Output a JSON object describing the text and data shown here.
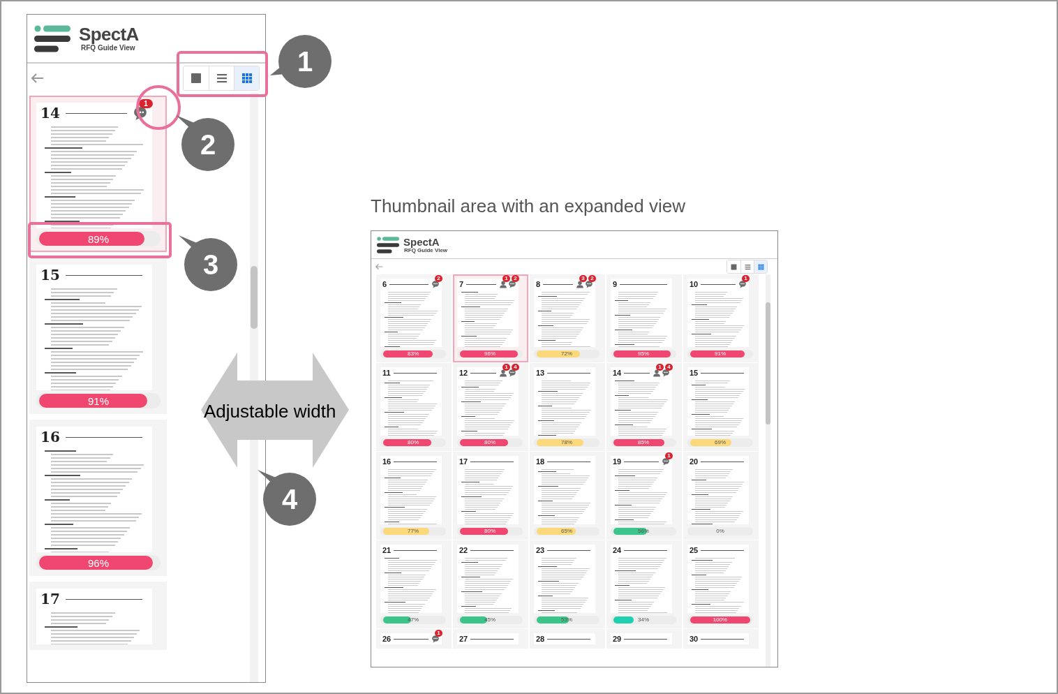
{
  "sidebar": {
    "logo": {
      "name": "SpectA",
      "subtitle": "RFQ Guide View"
    },
    "view_modes": [
      {
        "kind": "single",
        "selected": false
      },
      {
        "kind": "list",
        "selected": false
      },
      {
        "kind": "grid",
        "selected": true
      }
    ],
    "pages": [
      {
        "number": "14",
        "percent": "89%",
        "level": 0.89,
        "color": "#ef476f",
        "selected": true,
        "comments": [
          {
            "kind": "chat",
            "count": "1"
          }
        ]
      },
      {
        "number": "15",
        "percent": "91%",
        "level": 0.91,
        "color": "#ef476f",
        "selected": false
      },
      {
        "number": "16",
        "percent": "96%",
        "level": 0.96,
        "color": "#ef476f",
        "selected": false
      },
      {
        "number": "17",
        "selected": false
      }
    ]
  },
  "callouts": [
    {
      "label": "1"
    },
    {
      "label": "2"
    },
    {
      "label": "3"
    },
    {
      "label": "4"
    }
  ],
  "resize_arrow": {
    "label": "Adjustable width"
  },
  "expanded_view": {
    "caption": "Thumbnail area with an expanded view",
    "logo": {
      "name": "SpectA",
      "subtitle": "RFQ Guide View"
    },
    "view_modes": [
      {
        "kind": "single",
        "selected": false
      },
      {
        "kind": "list",
        "selected": false
      },
      {
        "kind": "grid",
        "selected": true
      }
    ],
    "pages": [
      {
        "number": "6",
        "percent": "83%",
        "level": 0.83,
        "color": "#ef476f",
        "selected": false,
        "comments": [
          {
            "kind": "chat",
            "count": "2"
          }
        ]
      },
      {
        "number": "7",
        "percent": "96%",
        "level": 0.96,
        "color": "#ef476f",
        "selected": true,
        "comments": [
          {
            "kind": "person",
            "count": "1"
          },
          {
            "kind": "chat",
            "count": "2"
          }
        ]
      },
      {
        "number": "8",
        "percent": "72%",
        "level": 0.72,
        "color": "#fbd97a",
        "selected": false,
        "comments": [
          {
            "kind": "person",
            "count": "3"
          },
          {
            "kind": "chat",
            "count": "2"
          }
        ]
      },
      {
        "number": "9",
        "percent": "95%",
        "level": 0.95,
        "color": "#ef476f",
        "selected": false
      },
      {
        "number": "10",
        "percent": "91%",
        "level": 0.91,
        "color": "#ef476f",
        "selected": false,
        "comments": [
          {
            "kind": "chat",
            "count": "1"
          }
        ]
      },
      {
        "number": "11",
        "percent": "80%",
        "level": 0.8,
        "color": "#ef476f",
        "selected": false
      },
      {
        "number": "12",
        "percent": "80%",
        "level": 0.8,
        "color": "#ef476f",
        "selected": false,
        "comments": [
          {
            "kind": "person",
            "count": "1"
          },
          {
            "kind": "chat",
            "count": "4"
          }
        ]
      },
      {
        "number": "13",
        "percent": "78%",
        "level": 0.78,
        "color": "#fbd97a",
        "selected": false
      },
      {
        "number": "14",
        "percent": "85%",
        "level": 0.85,
        "color": "#ef476f",
        "selected": false,
        "comments": [
          {
            "kind": "person",
            "count": "1"
          },
          {
            "kind": "chat",
            "count": "4"
          }
        ]
      },
      {
        "number": "15",
        "percent": "69%",
        "level": 0.69,
        "color": "#fbd97a",
        "selected": false
      },
      {
        "number": "16",
        "percent": "77%",
        "level": 0.77,
        "color": "#fbd97a",
        "selected": false
      },
      {
        "number": "17",
        "percent": "80%",
        "level": 0.8,
        "color": "#ef476f",
        "selected": false
      },
      {
        "number": "18",
        "percent": "65%",
        "level": 0.65,
        "color": "#fbd97a",
        "selected": false
      },
      {
        "number": "19",
        "percent": "56%",
        "level": 0.56,
        "color": "#3cc48a",
        "selected": false,
        "comments": [
          {
            "kind": "chat",
            "count": "1"
          }
        ]
      },
      {
        "number": "20",
        "percent": "0%",
        "level": 0,
        "selected": false
      },
      {
        "number": "21",
        "percent": "47%",
        "level": 0.47,
        "color": "#3cc48a",
        "selected": false
      },
      {
        "number": "22",
        "percent": "45%",
        "level": 0.45,
        "color": "#3cc48a",
        "selected": false
      },
      {
        "number": "23",
        "percent": "53%",
        "level": 0.53,
        "color": "#3cc48a",
        "selected": false
      },
      {
        "number": "24",
        "percent": "34%",
        "level": 0.34,
        "color": "#1fcfb0",
        "selected": false
      },
      {
        "number": "25",
        "percent": "100%",
        "level": 1,
        "color": "#ef476f",
        "selected": false
      },
      {
        "number": "26",
        "selected": false,
        "comments": [
          {
            "kind": "chat",
            "count": "1"
          }
        ]
      },
      {
        "number": "27",
        "selected": false
      },
      {
        "number": "28",
        "selected": false
      },
      {
        "number": "29",
        "selected": false
      },
      {
        "number": "30",
        "selected": false
      }
    ]
  }
}
